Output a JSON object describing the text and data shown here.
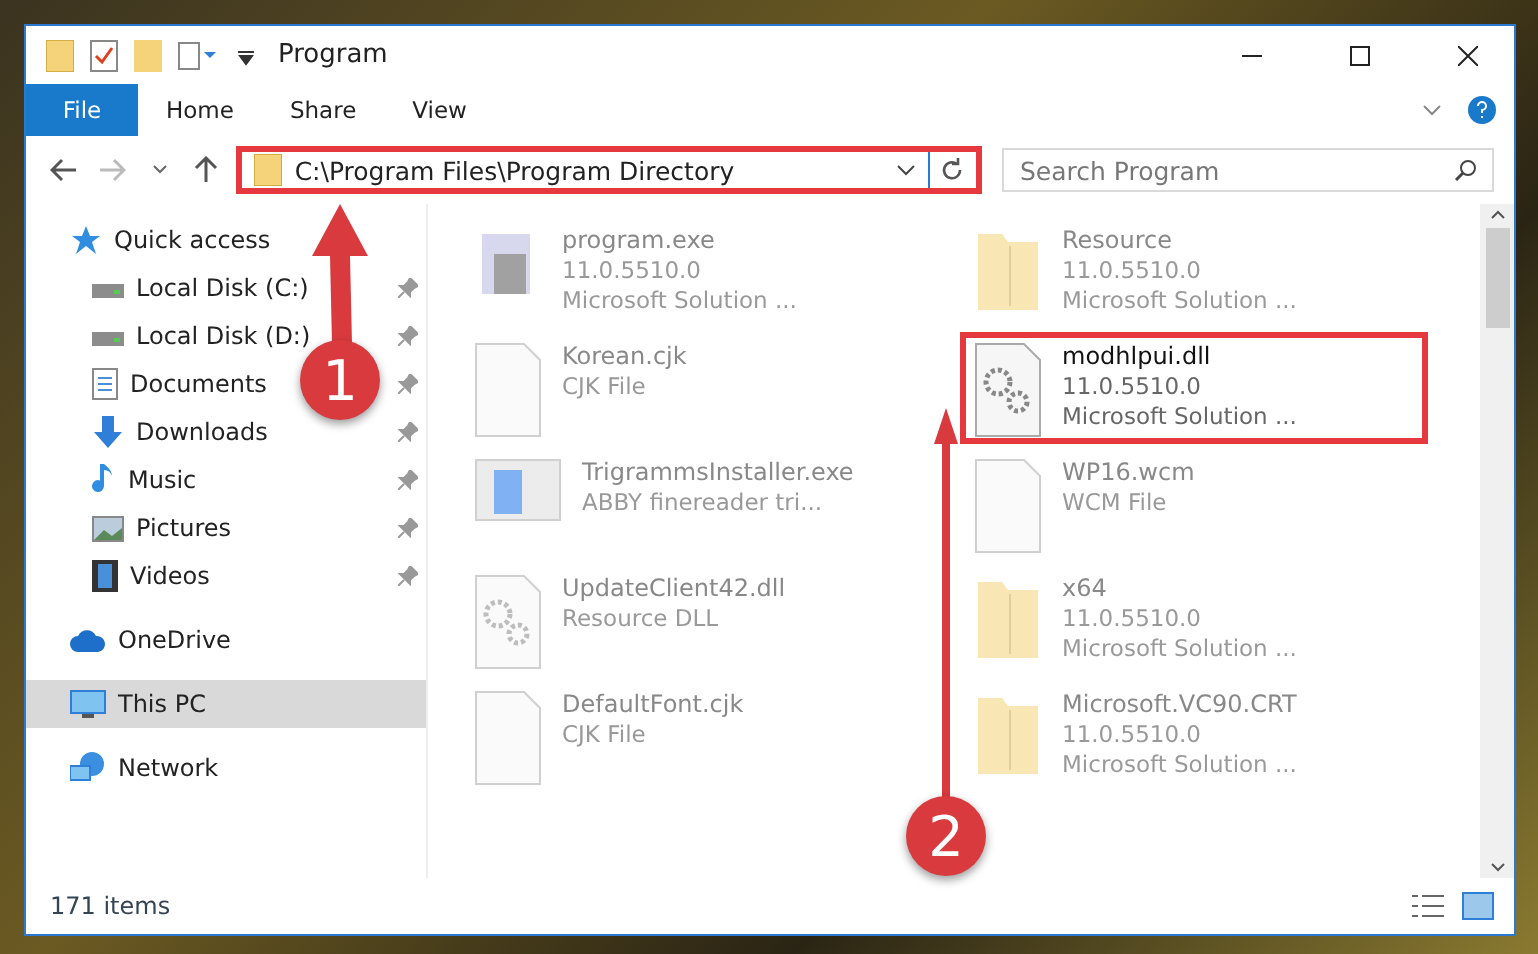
{
  "window": {
    "title": "Program"
  },
  "ribbon": {
    "file_button": "File",
    "tabs": [
      {
        "label": "Home",
        "selected": false
      },
      {
        "label": "Share",
        "selected": false
      },
      {
        "label": "View",
        "selected": false
      }
    ]
  },
  "address": {
    "path": "C:\\Program Files\\Program Directory",
    "highlighted": true
  },
  "search": {
    "placeholder": "Search Program"
  },
  "sidebar": {
    "items": [
      {
        "label": "Quick access",
        "kind": "star",
        "selected": false,
        "children": [
          {
            "label": "Local Disk (C:)",
            "kind": "drive",
            "selected": false
          },
          {
            "label": "Local Disk (D:)",
            "kind": "drive",
            "selected": false
          },
          {
            "label": "Documents",
            "kind": "document",
            "selected": false
          },
          {
            "label": "Downloads",
            "kind": "download",
            "selected": false
          },
          {
            "label": "Music",
            "kind": "music",
            "selected": false
          },
          {
            "label": "Pictures",
            "kind": "picture",
            "selected": false
          },
          {
            "label": "Videos",
            "kind": "video",
            "selected": false
          }
        ]
      },
      {
        "label": "OneDrive",
        "kind": "cloud",
        "selected": false
      },
      {
        "label": "This PC",
        "kind": "pc",
        "selected": true
      },
      {
        "label": "Network",
        "kind": "network",
        "selected": false
      }
    ]
  },
  "files": [
    {
      "name": "program.exe",
      "details": [
        "11.0.5510.0",
        "Microsoft Solution ..."
      ],
      "kind": "app",
      "highlighted": false
    },
    {
      "name": "Resource",
      "details": [
        "11.0.5510.0",
        "Microsoft Solution ..."
      ],
      "kind": "folder",
      "highlighted": false
    },
    {
      "name": "Korean.cjk",
      "details": [
        "CJK File"
      ],
      "kind": "file",
      "highlighted": false
    },
    {
      "name": "modhlpui.dll",
      "details": [
        "11.0.5510.0",
        "Microsoft Solution ..."
      ],
      "kind": "gear",
      "highlighted": true
    },
    {
      "name": "TrigrammsInstaller.exe",
      "details": [
        "ABBY finereader tri..."
      ],
      "kind": "installer",
      "highlighted": false
    },
    {
      "name": "WP16.wcm",
      "details": [
        "WCM File"
      ],
      "kind": "file",
      "highlighted": false
    },
    {
      "name": "UpdateClient42.dll",
      "details": [
        "Resource DLL"
      ],
      "kind": "gear",
      "highlighted": false
    },
    {
      "name": "x64",
      "details": [
        "11.0.5510.0",
        "Microsoft Solution ..."
      ],
      "kind": "folder",
      "highlighted": false
    },
    {
      "name": "DefaultFont.cjk",
      "details": [
        "CJK File"
      ],
      "kind": "file",
      "highlighted": false
    },
    {
      "name": "Microsoft.VC90.CRT",
      "details": [
        "11.0.5510.0",
        "Microsoft Solution ..."
      ],
      "kind": "folder",
      "highlighted": false
    }
  ],
  "status_bar": {
    "count": "171 items"
  },
  "annotations": [
    {
      "label": "1"
    },
    {
      "label": "2"
    }
  ]
}
